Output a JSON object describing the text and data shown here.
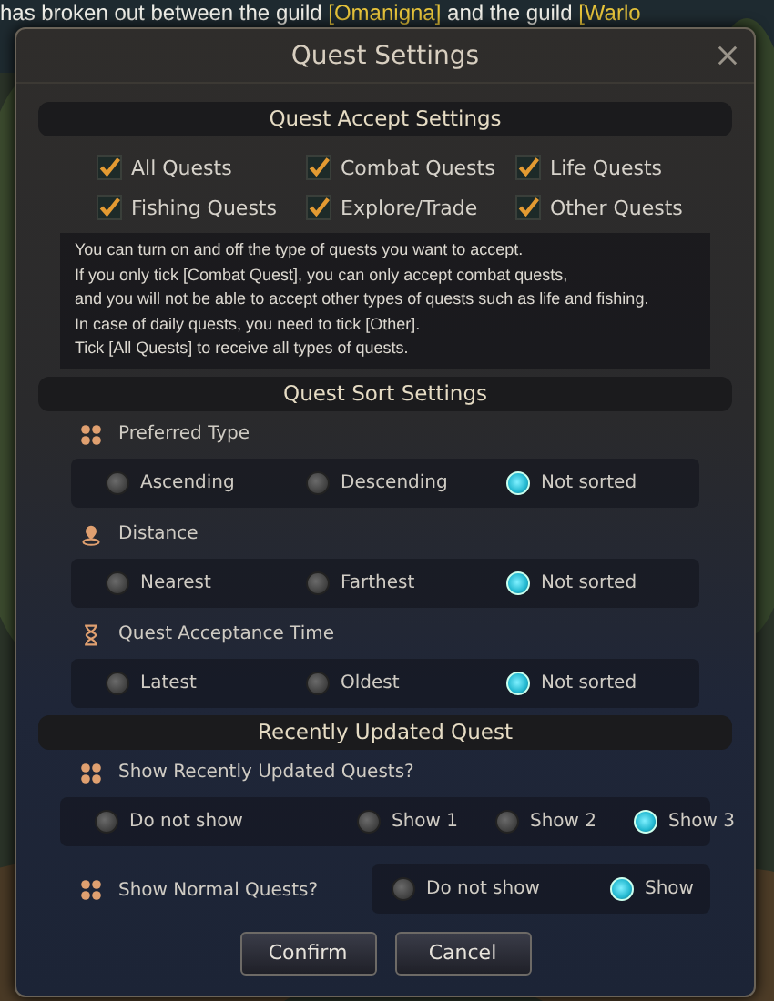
{
  "banner": {
    "segments": [
      {
        "kind": "plain",
        "text": "has broken out between the guild "
      },
      {
        "kind": "name",
        "text": "[Omanigna]"
      },
      {
        "kind": "plain",
        "text": " and the guild "
      },
      {
        "kind": "name",
        "text": "[Warlo"
      }
    ]
  },
  "window": {
    "title": "Quest Settings"
  },
  "accept": {
    "heading": "Quest Accept Settings",
    "options": [
      {
        "label": "All Quests",
        "checked": true
      },
      {
        "label": "Combat Quests",
        "checked": true
      },
      {
        "label": "Life Quests",
        "checked": true
      },
      {
        "label": "Fishing Quests",
        "checked": true
      },
      {
        "label": "Explore/Trade",
        "checked": true
      },
      {
        "label": "Other Quests",
        "checked": true
      }
    ],
    "note": [
      "You can turn on and off the type of quests you want to accept.",
      "If you only tick [Combat Quest], you can only accept combat quests,",
      "and you will not be able to accept other types of quests such as life and fishing.",
      "In case of daily quests, you need to tick [Other].",
      "Tick [All Quests] to receive all types of quests."
    ]
  },
  "sort": {
    "heading": "Quest Sort Settings",
    "groups": [
      {
        "label": "Preferred Type",
        "options": [
          {
            "label": "Ascending",
            "selected": false
          },
          {
            "label": "Descending",
            "selected": false
          },
          {
            "label": "Not sorted",
            "selected": true
          }
        ]
      },
      {
        "label": "Distance",
        "options": [
          {
            "label": "Nearest",
            "selected": false
          },
          {
            "label": "Farthest",
            "selected": false
          },
          {
            "label": "Not sorted",
            "selected": true
          }
        ]
      },
      {
        "label": "Quest Acceptance Time",
        "options": [
          {
            "label": "Latest",
            "selected": false
          },
          {
            "label": "Oldest",
            "selected": false
          },
          {
            "label": "Not sorted",
            "selected": true
          }
        ]
      }
    ]
  },
  "recent": {
    "heading": "Recently Updated Quest",
    "groups": [
      {
        "label": "Show Recently Updated Quests?",
        "options": [
          {
            "label": "Do not show",
            "selected": false
          },
          {
            "label": "Show 1",
            "selected": false
          },
          {
            "label": "Show 2",
            "selected": false
          },
          {
            "label": "Show 3",
            "selected": true
          }
        ]
      },
      {
        "label": "Show Normal Quests?",
        "options": [
          {
            "label": "Do not show",
            "selected": false
          },
          {
            "label": "Show",
            "selected": true
          }
        ]
      }
    ]
  },
  "buttons": [
    "Confirm",
    "Cancel"
  ]
}
